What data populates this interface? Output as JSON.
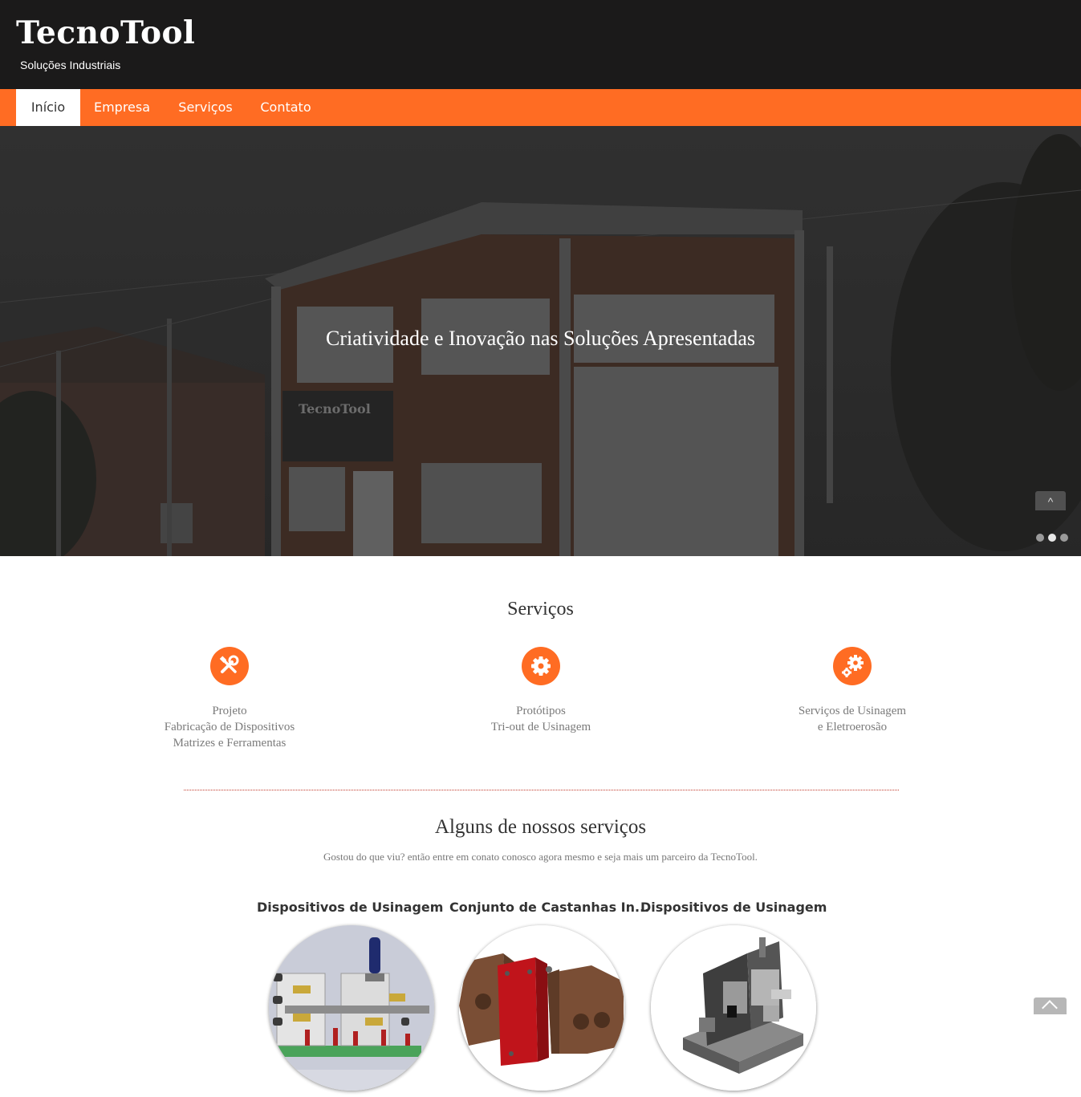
{
  "header": {
    "brand": "TecnoTool",
    "tagline": "Soluções Industriais"
  },
  "nav": {
    "items": [
      "Início",
      "Empresa",
      "Serviços",
      "Contato"
    ],
    "active": "Início"
  },
  "hero": {
    "caption": "Criatividade e Inovação nas Soluções Apresentadas",
    "building_sign": "TecnoTool",
    "slides": 3,
    "active_slide": 2
  },
  "services": {
    "title": "Serviços",
    "items": [
      {
        "icon": "tools-icon",
        "lines": [
          "Projeto",
          "Fabricação de Dispositivos",
          "Matrizes e Ferramentas"
        ]
      },
      {
        "icon": "gear-icon",
        "lines": [
          "Protótipos",
          "Tri-out de Usinagem"
        ]
      },
      {
        "icon": "gears-icon",
        "lines": [
          "Serviços de Usinagem",
          "e Eletroerosão"
        ]
      }
    ]
  },
  "portfolio": {
    "title": "Alguns de nossos serviços",
    "subtitle": "Gostou do que viu? então entre em conato conosco agora mesmo e seja mais um parceiro da TecnoTool.",
    "items": [
      {
        "title": "Dispositivos de Usinagem"
      },
      {
        "title": "Conjunto de Castanhas In..."
      },
      {
        "title": "Dispositivos de Usinagem"
      }
    ]
  },
  "colors": {
    "accent": "#ff6c23",
    "header_bg": "#1b1a1a",
    "text": "#333333",
    "muted": "#7a7a7a"
  }
}
